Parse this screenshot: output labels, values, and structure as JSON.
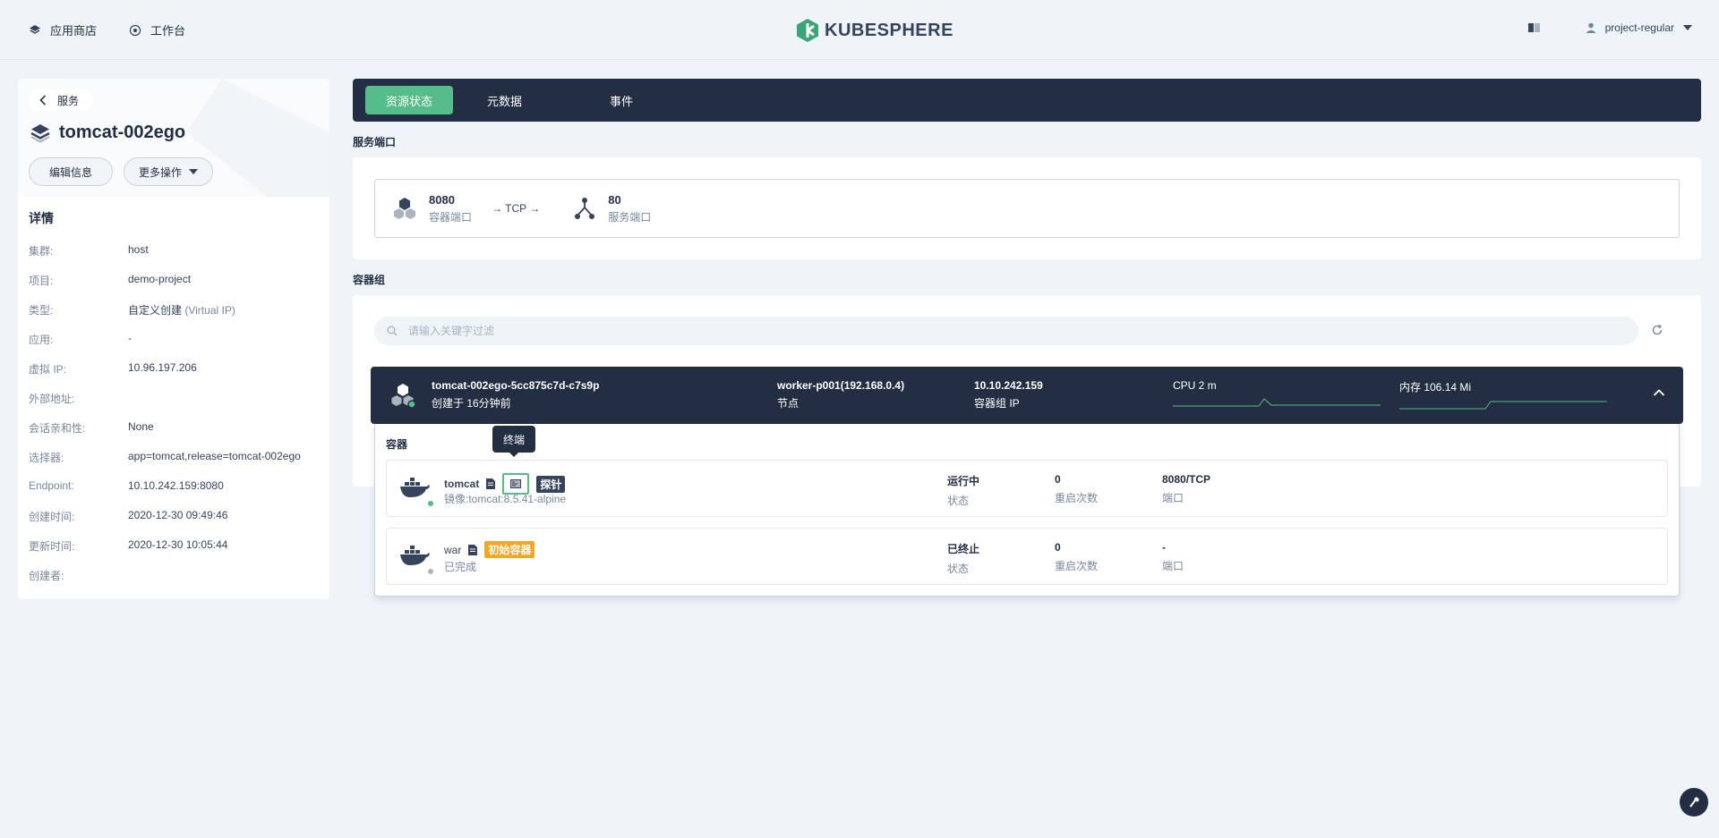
{
  "topbar": {
    "nav": [
      {
        "label": "应用商店",
        "icon": "app-store-icon"
      },
      {
        "label": "工作台",
        "icon": "workbench-icon"
      }
    ],
    "brand": "KUBESPHERE",
    "user": "project-regular"
  },
  "left": {
    "back_label": "服务",
    "title": "tomcat-002ego",
    "edit_label": "编辑信息",
    "more_label": "更多操作",
    "details_title": "详情",
    "details": [
      {
        "key": "集群:",
        "value": "host",
        "extra": ""
      },
      {
        "key": "项目:",
        "value": "demo-project",
        "extra": ""
      },
      {
        "key": "类型:",
        "value": "自定义创建",
        "extra": "(Virtual IP)"
      },
      {
        "key": "应用:",
        "value": "-",
        "extra": ""
      },
      {
        "key": "虚拟 IP:",
        "value": "10.96.197.206",
        "extra": ""
      },
      {
        "key": "外部地址:",
        "value": "",
        "extra": ""
      },
      {
        "key": "会话亲和性:",
        "value": "None",
        "extra": ""
      },
      {
        "key": "选择器:",
        "value": "app=tomcat,release=tomcat-002ego",
        "extra": ""
      },
      {
        "key": "Endpoint:",
        "value": "10.10.242.159:8080",
        "extra": ""
      },
      {
        "key": "创建时间:",
        "value": "2020-12-30 09:49:46",
        "extra": ""
      },
      {
        "key": "更新时间:",
        "value": "2020-12-30 10:05:44",
        "extra": ""
      },
      {
        "key": "创建者:",
        "value": "",
        "extra": ""
      }
    ]
  },
  "tabs": [
    "资源状态",
    "元数据",
    "事件"
  ],
  "ports": {
    "section_label": "服务端口",
    "container_port": "8080",
    "container_port_label": "容器端口",
    "protocol": "→ TCP →",
    "service_port": "80",
    "service_port_label": "服务端口"
  },
  "pods": {
    "section_label": "容器组",
    "search_placeholder": "请输入关键字过滤",
    "pod": {
      "name": "tomcat-002ego-5cc875c7d-c7s9p",
      "created": "创建于 16分钟前",
      "node": "worker-p001(192.168.0.4)",
      "node_label": "节点",
      "ip": "10.10.242.159",
      "ip_label": "容器组 IP",
      "cpu": "CPU 2 m",
      "memory": "内存 106.14 Mi"
    },
    "containers_label": "容器",
    "tooltip": "终端",
    "containers": [
      {
        "name": "tomcat",
        "tag": "探针",
        "sub": "镜像:tomcat:8.5.41-alpine",
        "status": "运行中",
        "status_label": "状态",
        "restarts": "0",
        "restarts_label": "重启次数",
        "ports": "8080/TCP",
        "ports_label": "端口",
        "status_color": "#55bc8a"
      },
      {
        "name": "war",
        "tag": "初始容器",
        "sub": "已完成",
        "status": "已终止",
        "status_label": "状态",
        "restarts": "0",
        "restarts_label": "重启次数",
        "ports": "-",
        "ports_label": "端口",
        "status_color": "#abb4be"
      }
    ]
  }
}
